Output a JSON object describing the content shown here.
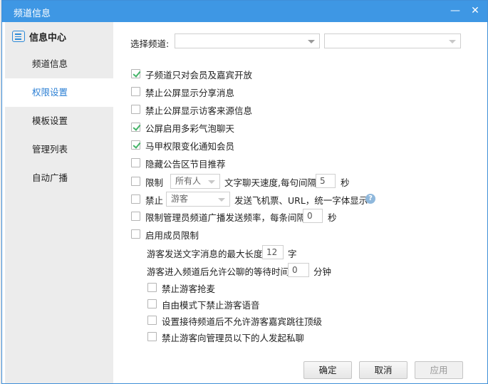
{
  "window": {
    "title": "频道信息",
    "min_icon": "minimize-icon",
    "close_icon": "close-icon"
  },
  "sidebar": {
    "header": "信息中心",
    "items": [
      {
        "label": "频道信息"
      },
      {
        "label": "权限设置"
      },
      {
        "label": "模板设置"
      },
      {
        "label": "管理列表"
      },
      {
        "label": "自动广播"
      }
    ]
  },
  "channel_select": {
    "label": "选择频道:",
    "first_value": "",
    "second_value": ""
  },
  "options": [
    {
      "label": "子频道只对会员及嘉宾开放",
      "checked": true
    },
    {
      "label": "禁止公屏显示分享消息",
      "checked": false
    },
    {
      "label": "禁止公屏显示访客来源信息",
      "checked": false
    },
    {
      "label": "公屏启用多彩气泡聊天",
      "checked": true
    },
    {
      "label": "马甲权限变化通知会员",
      "checked": true
    },
    {
      "label": "隐藏公告区节目推荐",
      "checked": false
    }
  ],
  "limit_speed": {
    "prefix": "限制",
    "target": "所有人",
    "text": "文字聊天速度,每句间隔",
    "value": "5",
    "unit": "秒",
    "checked": false
  },
  "ban_flight": {
    "prefix": "禁止",
    "target": "游客",
    "text": "发送飞机票、URL，统一字体显示",
    "help": "?",
    "checked": false
  },
  "admin_broadcast": {
    "text": "限制管理员频道广播发送频率，每条间隔",
    "value": "0",
    "unit": "秒",
    "checked": false
  },
  "member_limit": {
    "label": "启用成员限制",
    "checked": false,
    "max_length": {
      "text": "游客发送文字消息的最大长度",
      "value": "12",
      "unit": "字"
    },
    "wait_time": {
      "text": "游客进入频道后允许公聊的等待时间",
      "value": "0",
      "unit": "分钟"
    },
    "sub_options": [
      {
        "label": "禁止游客抢麦",
        "checked": false
      },
      {
        "label": "自由模式下禁止游客语音",
        "checked": false
      },
      {
        "label": "设置接待频道后不允许游客嘉宾跳往顶级",
        "checked": false
      },
      {
        "label": "禁止游客向管理员以下的人发起私聊",
        "checked": false
      }
    ]
  },
  "buttons": {
    "ok": "确定",
    "cancel": "取消",
    "apply": "应用"
  },
  "colors": {
    "titlebar": "#3e97e4",
    "active_text": "#2b7fd4",
    "check": "#44b468"
  }
}
